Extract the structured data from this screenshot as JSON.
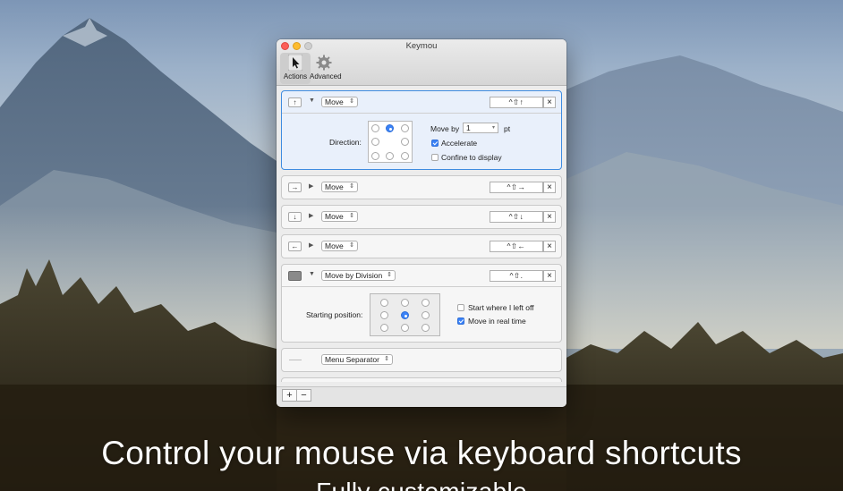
{
  "window": {
    "title": "Keymou",
    "toolbar": [
      {
        "label": "Actions",
        "icon": "cursor-arrow-icon",
        "selected": true
      },
      {
        "label": "Advanced",
        "icon": "gear-icon",
        "selected": false
      }
    ]
  },
  "actions": [
    {
      "icon": "↑",
      "expanded": true,
      "action": "Move",
      "shortcut": "^⇧↑",
      "details": {
        "direction_label": "Direction:",
        "move_by_label": "Move by",
        "move_by_value": "1",
        "move_by_unit": "pt",
        "accelerate_label": "Accelerate",
        "accelerate_checked": true,
        "confine_label": "Confine to display",
        "confine_checked": false
      }
    },
    {
      "icon": "→",
      "expanded": false,
      "action": "Move",
      "shortcut": "^⇧→"
    },
    {
      "icon": "↓",
      "expanded": false,
      "action": "Move",
      "shortcut": "^⇧↓"
    },
    {
      "icon": "←",
      "expanded": false,
      "action": "Move",
      "shortcut": "^⇧←"
    },
    {
      "icon": "",
      "expanded": true,
      "action": "Move by Division",
      "shortcut": "^⇧.",
      "details": {
        "starting_label": "Starting position:",
        "start_where_left_label": "Start where I left off",
        "start_where_left_checked": false,
        "real_time_label": "Move in real time",
        "real_time_checked": true
      }
    },
    {
      "icon": "",
      "expanded": false,
      "action": "Menu Separator",
      "shortcut": ""
    }
  ],
  "bottom": {
    "add": "+",
    "remove": "−"
  },
  "tagline": "Control your mouse via keyboard shortcuts",
  "subtagline": "Fully customizable"
}
